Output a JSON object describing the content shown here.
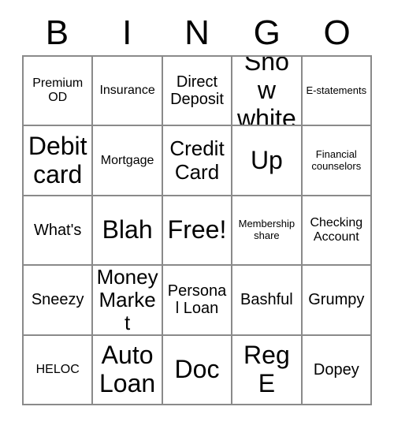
{
  "card": {
    "title_letters": [
      "B",
      "I",
      "N",
      "G",
      "O"
    ],
    "columns": 5,
    "rows": 5,
    "grid_color": "#8a8a8a",
    "text_color": "#000000",
    "background_color": "#ffffff",
    "cells": [
      [
        {
          "label": "Premium OD",
          "size": "sm"
        },
        {
          "label": "Insurance",
          "size": "sm"
        },
        {
          "label": "Direct Deposit",
          "size": "md"
        },
        {
          "label": "Snow white",
          "size": "xl"
        },
        {
          "label": "E-statements",
          "size": "xs"
        }
      ],
      [
        {
          "label": "Debit card",
          "size": "xl"
        },
        {
          "label": "Mortgage",
          "size": "sm"
        },
        {
          "label": "Credit Card",
          "size": "lg"
        },
        {
          "label": "Up",
          "size": "xl"
        },
        {
          "label": "Financial counselors",
          "size": "xs"
        }
      ],
      [
        {
          "label": "What's",
          "size": "md"
        },
        {
          "label": "Blah",
          "size": "xl"
        },
        {
          "label": "Free!",
          "size": "xl"
        },
        {
          "label": "Membership share",
          "size": "xs"
        },
        {
          "label": "Checking Account",
          "size": "sm"
        }
      ],
      [
        {
          "label": "Sneezy",
          "size": "md"
        },
        {
          "label": "Money Market",
          "size": "lg"
        },
        {
          "label": "Personal Loan",
          "size": "md"
        },
        {
          "label": "Bashful",
          "size": "md"
        },
        {
          "label": "Grumpy",
          "size": "md"
        }
      ],
      [
        {
          "label": "HELOC",
          "size": "sm"
        },
        {
          "label": "Auto Loan",
          "size": "xl"
        },
        {
          "label": "Doc",
          "size": "xl"
        },
        {
          "label": "Reg E",
          "size": "xl"
        },
        {
          "label": "Dopey",
          "size": "md"
        }
      ]
    ]
  }
}
